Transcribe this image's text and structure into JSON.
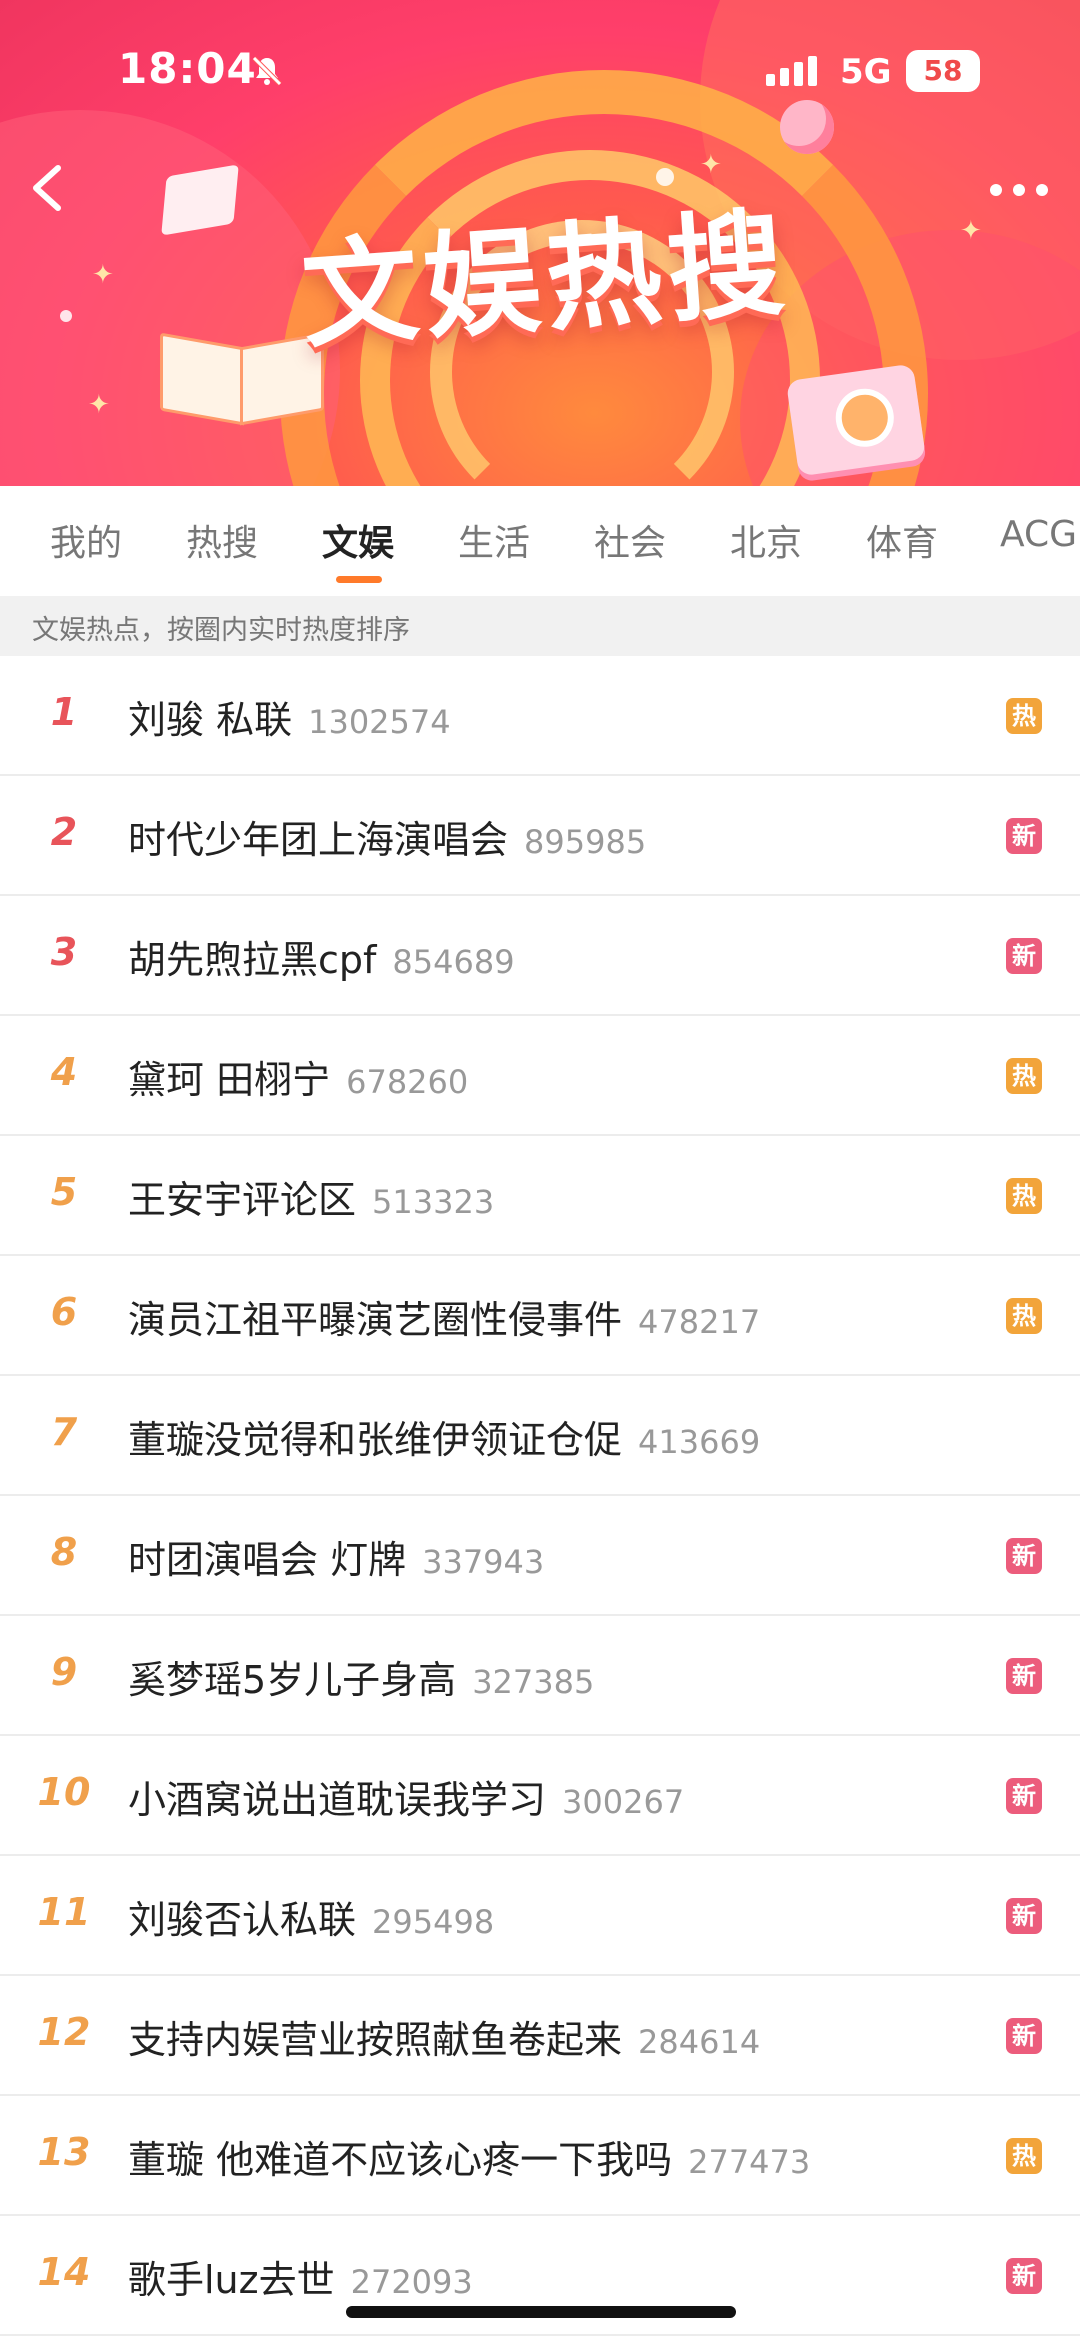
{
  "status_bar": {
    "time": "18:04",
    "network": "5G",
    "battery": "58"
  },
  "banner": {
    "title": "文娱热搜"
  },
  "tabs": [
    {
      "label": "我的",
      "active": false
    },
    {
      "label": "热搜",
      "active": false
    },
    {
      "label": "文娱",
      "active": true
    },
    {
      "label": "生活",
      "active": false
    },
    {
      "label": "社会",
      "active": false
    },
    {
      "label": "北京",
      "active": false
    },
    {
      "label": "体育",
      "active": false
    },
    {
      "label": "ACG",
      "active": false
    }
  ],
  "subheader": "文娱热点，按圈内实时热度排序",
  "badge_colors": {
    "hot": "#f2a43a",
    "new": "#ec5c7c"
  },
  "rank_colors": {
    "top3": "#e8545a",
    "other": "#f0a04b"
  },
  "list": [
    {
      "rank": "1",
      "title": "刘骏 私联",
      "count": "1302574",
      "badge": "热",
      "badge_type": "hot"
    },
    {
      "rank": "2",
      "title": "时代少年团上海演唱会",
      "count": "895985",
      "badge": "新",
      "badge_type": "new"
    },
    {
      "rank": "3",
      "title": "胡先煦拉黑cpf",
      "count": "854689",
      "badge": "新",
      "badge_type": "new"
    },
    {
      "rank": "4",
      "title": "黛珂 田栩宁",
      "count": "678260",
      "badge": "热",
      "badge_type": "hot"
    },
    {
      "rank": "5",
      "title": "王安宇评论区",
      "count": "513323",
      "badge": "热",
      "badge_type": "hot"
    },
    {
      "rank": "6",
      "title": "演员江祖平曝演艺圈性侵事件",
      "count": "478217",
      "badge": "热",
      "badge_type": "hot"
    },
    {
      "rank": "7",
      "title": "董璇没觉得和张维伊领证仓促",
      "count": "413669",
      "badge": "",
      "badge_type": ""
    },
    {
      "rank": "8",
      "title": "时团演唱会 灯牌",
      "count": "337943",
      "badge": "新",
      "badge_type": "new"
    },
    {
      "rank": "9",
      "title": "奚梦瑶5岁儿子身高",
      "count": "327385",
      "badge": "新",
      "badge_type": "new"
    },
    {
      "rank": "10",
      "title": "小酒窝说出道耽误我学习",
      "count": "300267",
      "badge": "新",
      "badge_type": "new"
    },
    {
      "rank": "11",
      "title": "刘骏否认私联",
      "count": "295498",
      "badge": "新",
      "badge_type": "new"
    },
    {
      "rank": "12",
      "title": "支持内娱营业按照献鱼卷起来",
      "count": "284614",
      "badge": "新",
      "badge_type": "new"
    },
    {
      "rank": "13",
      "title": "董璇 他难道不应该心疼一下我吗",
      "count": "277473",
      "badge": "热",
      "badge_type": "hot"
    },
    {
      "rank": "14",
      "title": "歌手luz去世",
      "count": "272093",
      "badge": "新",
      "badge_type": "new"
    }
  ]
}
